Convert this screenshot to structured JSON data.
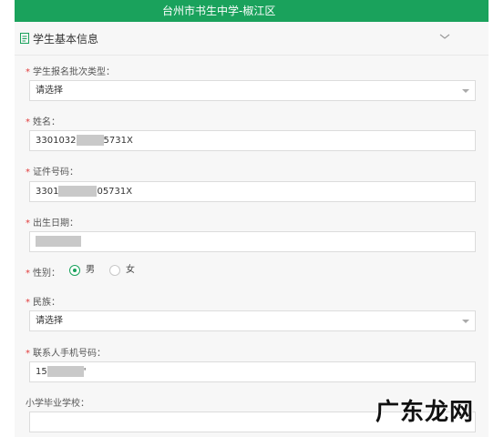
{
  "header": {
    "title": "台州市书生中学-椒江区"
  },
  "section": {
    "title": "学生基本信息",
    "icon": "document-icon",
    "toggle_icon": "chevron-down-icon"
  },
  "fields": {
    "batch_type": {
      "label": "学生报名批次类型：",
      "value": "请选择",
      "required": "*"
    },
    "name": {
      "label": "姓名：",
      "value_prefix": "3301032",
      "value_suffix": "5731X",
      "required": "*"
    },
    "id_number": {
      "label": "证件号码：",
      "value_prefix": "3301",
      "value_suffix": "05731X",
      "required": "*"
    },
    "birth_date": {
      "label": "出生日期：",
      "required": "*"
    },
    "gender": {
      "label": "性别：",
      "options": [
        "男",
        "女"
      ],
      "selected": "男",
      "required": "*"
    },
    "ethnicity": {
      "label": "民族：",
      "value": "请选择",
      "required": "*"
    },
    "phone": {
      "label": "联系人手机号码：",
      "value_prefix": "15",
      "value_suffix": "'",
      "required": "*"
    },
    "primary_school": {
      "label": "小学毕业学校：",
      "value": ""
    }
  },
  "watermark": {
    "text": "广东龙网"
  },
  "colors": {
    "accent": "#1aa25c",
    "required": "#e23b3b"
  }
}
